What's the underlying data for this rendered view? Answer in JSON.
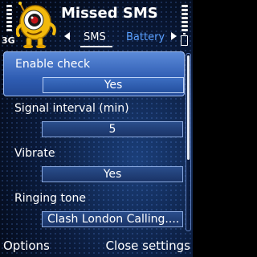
{
  "header": {
    "app_title": "Missed SMS",
    "network": "3G",
    "signal_level": 0.85,
    "battery_level": 1.0,
    "tabs": [
      {
        "label": "SMS",
        "active": true
      },
      {
        "label": "Battery",
        "active": false
      }
    ]
  },
  "settings": [
    {
      "label": "Enable check",
      "value": "Yes",
      "selected": true
    },
    {
      "label": "Signal interval (min)",
      "value": "5",
      "selected": false
    },
    {
      "label": "Vibrate",
      "value": "Yes",
      "selected": false
    },
    {
      "label": "Ringing tone",
      "value": "Clash London Calling....",
      "selected": false
    }
  ],
  "softkeys": {
    "left": "Options",
    "right": "Close settings"
  },
  "colors": {
    "accent": "#3d6ec2",
    "inactive_tab": "#5aa0ff",
    "background": "#0a1a3a"
  },
  "icons": {
    "logo": "yellow-cartoon-character-icon",
    "tab_prev": "arrow-left-icon",
    "tab_next": "arrow-right-icon",
    "battery": "battery-icon"
  }
}
